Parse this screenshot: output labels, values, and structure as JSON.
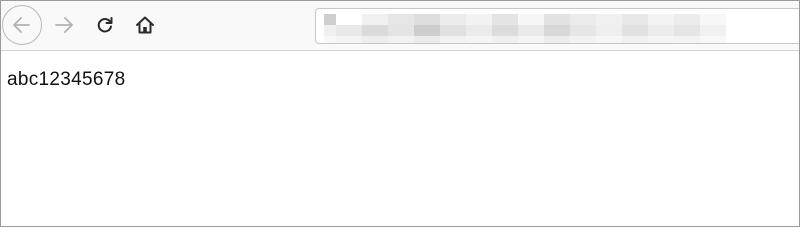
{
  "toolbar": {
    "back_icon": "arrow-left-icon",
    "forward_icon": "arrow-right-icon",
    "reload_icon": "reload-icon",
    "home_icon": "home-icon"
  },
  "address_bar": {
    "url": ""
  },
  "page": {
    "text": "abc12345678"
  },
  "colors": {
    "toolbar_bg": "#f9f9fa",
    "icon_active": "#2b2b2b",
    "icon_disabled": "#b1b1b3"
  }
}
